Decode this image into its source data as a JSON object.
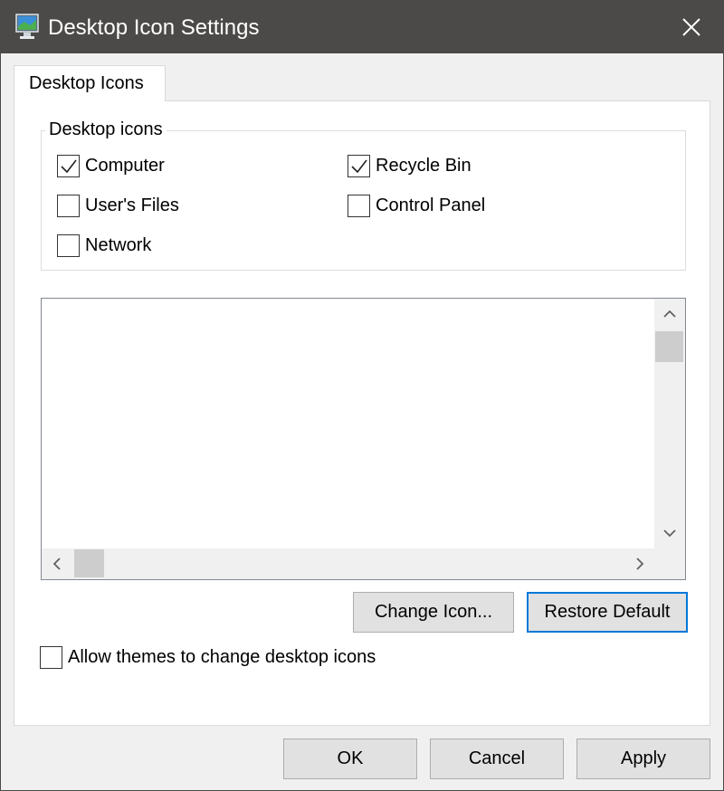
{
  "window": {
    "title": "Desktop Icon Settings",
    "icon": "monitor-icon",
    "close_icon": "close-icon"
  },
  "tabs": [
    {
      "label": "Desktop Icons",
      "selected": true
    }
  ],
  "group": {
    "legend": "Desktop icons",
    "checkboxes": [
      {
        "label": "Computer",
        "checked": true
      },
      {
        "label": "Recycle Bin",
        "checked": true
      },
      {
        "label": "User's Files",
        "checked": false
      },
      {
        "label": "Control Panel",
        "checked": false
      },
      {
        "label": "Network",
        "checked": false
      }
    ]
  },
  "icon_list": {
    "items": []
  },
  "buttons": {
    "change_icon": "Change Icon...",
    "restore_default": "Restore Default",
    "ok": "OK",
    "cancel": "Cancel",
    "apply": "Apply"
  },
  "allow_themes": {
    "label": "Allow themes to change desktop icons",
    "checked": false
  },
  "colors": {
    "titlebar": "#4b4a48",
    "focus_accent": "#0078d7",
    "button_face": "#e1e1e1"
  }
}
